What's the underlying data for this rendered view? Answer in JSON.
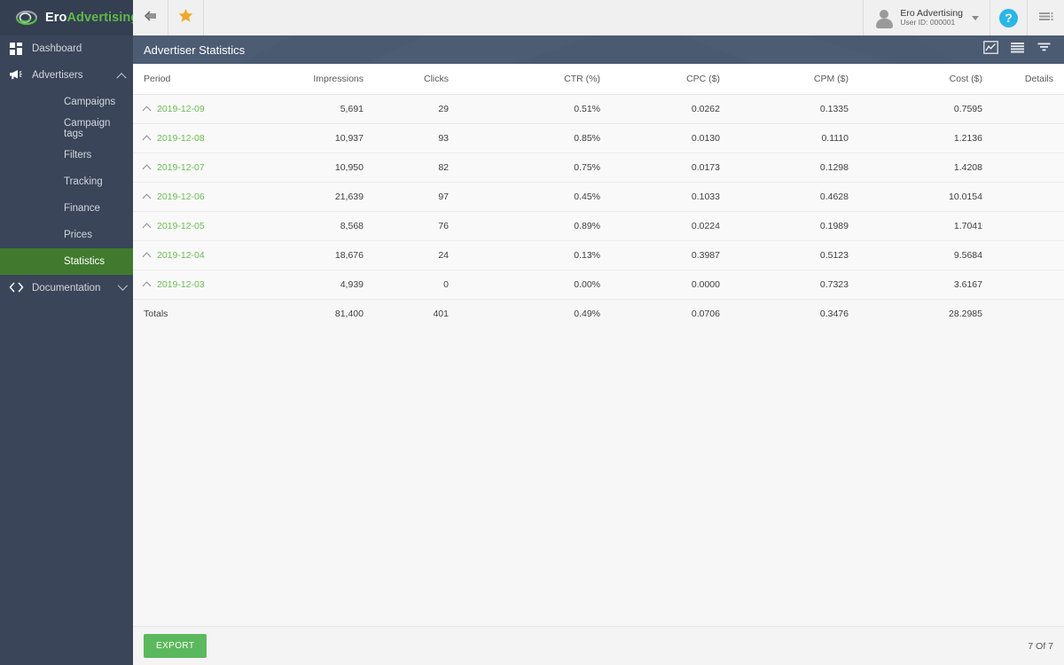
{
  "brand": {
    "name_part1": "Ero",
    "name_part2": "Advertising",
    "logo_icon": "eye-swirl-logo",
    "green": "#5fb84b",
    "dark": "#343f52"
  },
  "topbar": {
    "collapse_icon": "collapse-left-icon",
    "favorite_icon": "star-icon",
    "user": {
      "name": "Ero Advertising",
      "user_id": "User ID: 000001",
      "avatar_icon": "user-avatar-icon",
      "caret_icon": "chevron-down-icon"
    },
    "help_label": "?",
    "menu_icon": "list-menu-icon"
  },
  "sidebar": {
    "items": [
      {
        "label": "Dashboard",
        "icon": "grid-icon",
        "level": "top",
        "active": false,
        "chevron": ""
      },
      {
        "label": "Advertisers",
        "icon": "megaphone-icon",
        "level": "top",
        "active": false,
        "chevron": "up"
      },
      {
        "label": "Campaigns",
        "icon": "",
        "level": "child",
        "active": false,
        "chevron": ""
      },
      {
        "label": "Campaign tags",
        "icon": "",
        "level": "child",
        "active": false,
        "chevron": ""
      },
      {
        "label": "Filters",
        "icon": "",
        "level": "child",
        "active": false,
        "chevron": ""
      },
      {
        "label": "Tracking",
        "icon": "",
        "level": "child",
        "active": false,
        "chevron": ""
      },
      {
        "label": "Finance",
        "icon": "",
        "level": "child",
        "active": false,
        "chevron": ""
      },
      {
        "label": "Prices",
        "icon": "",
        "level": "child",
        "active": false,
        "chevron": ""
      },
      {
        "label": "Statistics",
        "icon": "",
        "level": "child",
        "active": true,
        "chevron": ""
      },
      {
        "label": "Documentation",
        "icon": "code-brackets-icon",
        "level": "top",
        "active": false,
        "chevron": "down"
      }
    ],
    "active_color": "#417a2e"
  },
  "page": {
    "title": "Advertiser Statistics",
    "tools": [
      {
        "icon": "chart-line-icon",
        "name": "chart-view-button"
      },
      {
        "icon": "list-rows-icon",
        "name": "list-view-button"
      },
      {
        "icon": "filter-funnel-icon",
        "name": "filter-button"
      }
    ]
  },
  "table": {
    "columns": [
      "Period",
      "Impressions",
      "Clicks",
      "CTR (%)",
      "CPC ($)",
      "CPM ($)",
      "Cost ($)",
      "Details"
    ],
    "rows": [
      {
        "period": "2019-12-09",
        "impressions": "5,691",
        "clicks": "29",
        "ctr": "0.51%",
        "cpc": "0.0262",
        "cpm": "0.1335",
        "cost": "0.7595",
        "details": ""
      },
      {
        "period": "2019-12-08",
        "impressions": "10,937",
        "clicks": "93",
        "ctr": "0.85%",
        "cpc": "0.0130",
        "cpm": "0.1110",
        "cost": "1.2136",
        "details": ""
      },
      {
        "period": "2019-12-07",
        "impressions": "10,950",
        "clicks": "82",
        "ctr": "0.75%",
        "cpc": "0.0173",
        "cpm": "0.1298",
        "cost": "1.4208",
        "details": ""
      },
      {
        "period": "2019-12-06",
        "impressions": "21,639",
        "clicks": "97",
        "ctr": "0.45%",
        "cpc": "0.1033",
        "cpm": "0.4628",
        "cost": "10.0154",
        "details": ""
      },
      {
        "period": "2019-12-05",
        "impressions": "8,568",
        "clicks": "76",
        "ctr": "0.89%",
        "cpc": "0.0224",
        "cpm": "0.1989",
        "cost": "1.7041",
        "details": ""
      },
      {
        "period": "2019-12-04",
        "impressions": "18,676",
        "clicks": "24",
        "ctr": "0.13%",
        "cpc": "0.3987",
        "cpm": "0.5123",
        "cost": "9.5684",
        "details": ""
      },
      {
        "period": "2019-12-03",
        "impressions": "4,939",
        "clicks": "0",
        "ctr": "0.00%",
        "cpc": "0.0000",
        "cpm": "0.7323",
        "cost": "3.6167",
        "details": ""
      }
    ],
    "totals": {
      "period": "Totals",
      "impressions": "81,400",
      "clicks": "401",
      "ctr": "0.49%",
      "cpc": "0.0706",
      "cpm": "0.3476",
      "cost": "28.2985",
      "details": ""
    },
    "row_expand_icon": "chevron-up-icon",
    "link_color": "#6bbd55"
  },
  "footer": {
    "export_label": "EXPORT",
    "page_count": "7 Of 7",
    "export_color": "#5cb85c"
  }
}
